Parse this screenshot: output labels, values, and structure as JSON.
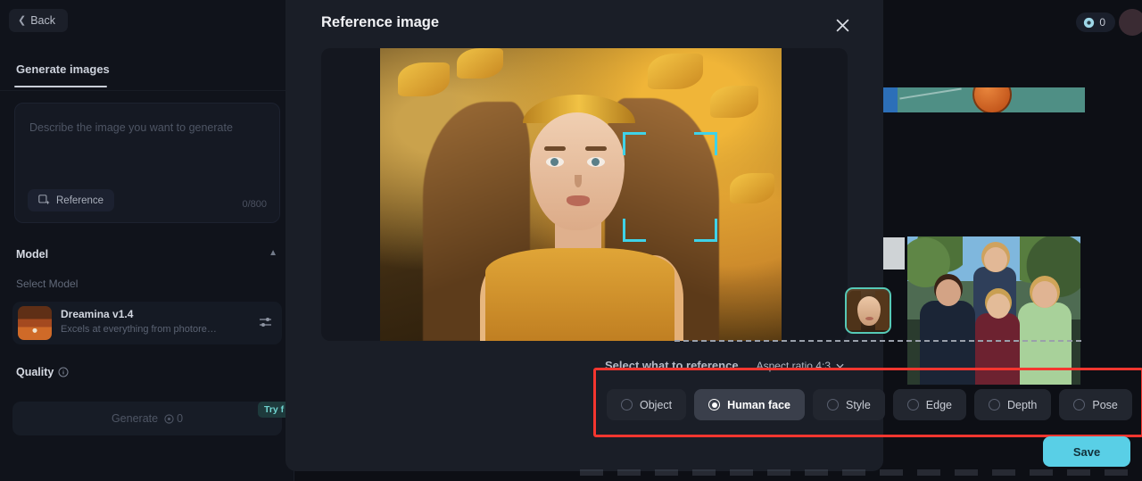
{
  "background": {
    "back_button": {
      "label": "Back",
      "icon": "chevron-left-icon"
    },
    "tab": {
      "label": "Generate images"
    },
    "prompt": {
      "placeholder": "Describe the image you want to generate",
      "value": "",
      "reference_button": "Reference",
      "char_count": "0/800"
    },
    "model_section": {
      "title": "Model",
      "select_label": "Select Model",
      "model_name": "Dreamina v1.4",
      "model_desc": "Excels at everything from photore…"
    },
    "quality_section": {
      "title": "Quality"
    },
    "generate": {
      "label": "Generate",
      "credits": "0",
      "badge": "Try f"
    },
    "credits_pill": {
      "value": "0"
    }
  },
  "modal": {
    "title": "Reference image",
    "close_icon": "close-icon",
    "select_what_label": "Select what to reference",
    "aspect_ratio": {
      "label": "Aspect ratio 4:3",
      "chevron": "chevron-down-icon"
    },
    "options": [
      {
        "label": "Object",
        "selected": false
      },
      {
        "label": "Human face",
        "selected": true
      },
      {
        "label": "Style",
        "selected": false
      },
      {
        "label": "Edge",
        "selected": false
      },
      {
        "label": "Depth",
        "selected": false
      },
      {
        "label": "Pose",
        "selected": false
      }
    ],
    "save_button": "Save"
  },
  "colors": {
    "accent_cyan": "#59cfe6",
    "bracket_cyan": "#3fd2e8",
    "annotation_red": "#f4362f",
    "modal_bg": "#1a1e27",
    "badge_teal": "#6fd3cf"
  }
}
